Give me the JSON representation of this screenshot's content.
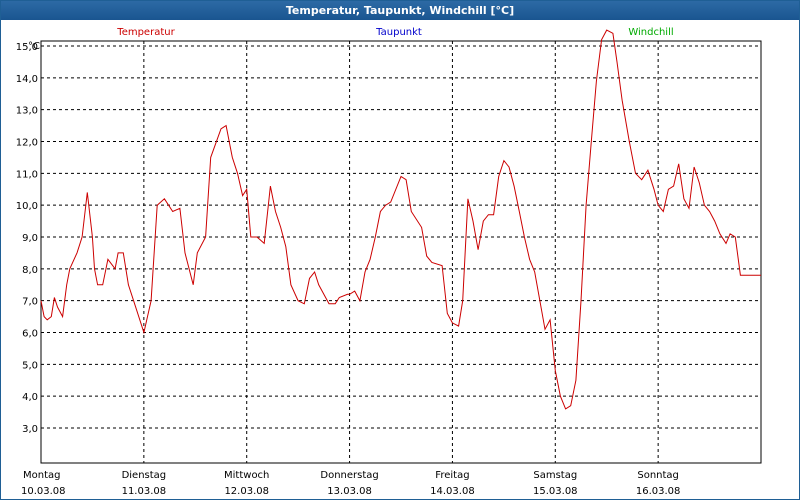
{
  "window": {
    "title": "Temperatur, Taupunkt, Windchill [°C]"
  },
  "colors": {
    "temperatur": "#cc0000",
    "taupunkt": "#0000cc",
    "windchill": "#00aa00",
    "titlebar": "#1f5f95"
  },
  "chart_data": {
    "type": "line",
    "title": "Temperatur, Taupunkt, Windchill [°C]",
    "ylabel": "°C",
    "ylim": [
      3.0,
      16.0
    ],
    "yticks": [
      "3,0",
      "4,0",
      "5,0",
      "6,0",
      "7,0",
      "8,0",
      "9,0",
      "10,0",
      "11,0",
      "12,0",
      "13,0",
      "14,0",
      "15,0"
    ],
    "xlim": [
      0,
      7
    ],
    "xticks": [
      {
        "day": "Montag",
        "date": "10.03.08"
      },
      {
        "day": "Dienstag",
        "date": "11.03.08"
      },
      {
        "day": "Mittwoch",
        "date": "12.03.08"
      },
      {
        "day": "Donnerstag",
        "date": "13.03.08"
      },
      {
        "day": "Freitag",
        "date": "14.03.08"
      },
      {
        "day": "Samstag",
        "date": "15.03.08"
      },
      {
        "day": "Sonntag",
        "date": "16.03.08"
      }
    ],
    "grid": true,
    "legend": [
      "Temperatur",
      "Taupunkt",
      "Windchill"
    ],
    "series": [
      {
        "name": "Temperatur",
        "x": [
          0,
          0.03,
          0.06,
          0.1,
          0.13,
          0.16,
          0.21,
          0.25,
          0.28,
          0.35,
          0.4,
          0.45,
          0.5,
          0.52,
          0.55,
          0.6,
          0.65,
          0.72,
          0.75,
          0.8,
          0.85,
          0.9,
          1.0,
          1.07,
          1.13,
          1.2,
          1.28,
          1.35,
          1.4,
          1.48,
          1.52,
          1.6,
          1.65,
          1.75,
          1.8,
          1.86,
          1.91,
          1.96,
          2.0,
          2.04,
          2.1,
          2.17,
          2.23,
          2.28,
          2.33,
          2.38,
          2.43,
          2.5,
          2.56,
          2.61,
          2.66,
          2.7,
          2.8,
          2.86,
          2.9,
          2.98,
          3.0,
          3.05,
          3.1,
          3.15,
          3.2,
          3.25,
          3.3,
          3.35,
          3.4,
          3.5,
          3.55,
          3.6,
          3.7,
          3.75,
          3.8,
          3.9,
          3.95,
          4.0,
          4.06,
          4.1,
          4.15,
          4.2,
          4.25,
          4.3,
          4.35,
          4.4,
          4.45,
          4.5,
          4.55,
          4.6,
          4.65,
          4.7,
          4.75,
          4.8,
          4.9,
          4.95,
          5.0,
          5.05,
          5.1,
          5.15,
          5.2,
          5.25,
          5.3,
          5.35,
          5.4,
          5.45,
          5.5,
          5.56,
          5.6,
          5.65,
          5.72,
          5.78,
          5.84,
          5.9,
          5.96,
          6.0,
          6.05,
          6.1,
          6.15,
          6.2,
          6.25,
          6.3,
          6.35,
          6.4,
          6.45,
          6.5,
          6.55,
          6.6,
          6.66,
          6.7,
          6.75,
          6.8,
          6.85,
          6.9,
          6.95,
          7.0
        ],
        "y": [
          7.0,
          6.5,
          6.4,
          6.5,
          7.1,
          6.8,
          6.5,
          7.5,
          8.0,
          8.5,
          9.0,
          10.4,
          9.0,
          8.0,
          7.5,
          7.5,
          8.3,
          8.0,
          8.5,
          8.5,
          7.5,
          7.0,
          6.0,
          7.0,
          10.0,
          10.2,
          9.8,
          9.9,
          8.5,
          7.5,
          8.5,
          9.0,
          11.5,
          12.4,
          12.5,
          11.5,
          11.0,
          10.3,
          10.5,
          9.0,
          9.0,
          8.8,
          10.6,
          9.8,
          9.3,
          8.7,
          7.5,
          7.0,
          6.9,
          7.7,
          7.9,
          7.5,
          6.9,
          6.9,
          7.1,
          7.2,
          7.2,
          7.3,
          7.0,
          7.9,
          8.3,
          9.0,
          9.8,
          10.0,
          10.1,
          10.9,
          10.8,
          9.8,
          9.3,
          8.4,
          8.2,
          8.1,
          6.6,
          6.3,
          6.2,
          7.0,
          10.2,
          9.5,
          8.6,
          9.5,
          9.7,
          9.7,
          10.9,
          11.4,
          11.2,
          10.6,
          9.8,
          9.0,
          8.3,
          7.9,
          6.1,
          6.4,
          4.8,
          4.0,
          3.6,
          3.7,
          4.5,
          7.0,
          10.0,
          12.0,
          13.9,
          15.2,
          15.5,
          15.4,
          14.5,
          13.3,
          12.0,
          11.0,
          10.8,
          11.1,
          10.5,
          10.0,
          9.8,
          10.5,
          10.6,
          11.3,
          10.2,
          9.9,
          11.2,
          10.7,
          10.0,
          9.8,
          9.5,
          9.1,
          8.8,
          9.1,
          9.0,
          7.8,
          7.8,
          7.8,
          7.8,
          7.8
        ]
      },
      {
        "name": "Taupunkt",
        "x": [],
        "y": []
      },
      {
        "name": "Windchill",
        "x": [],
        "y": []
      }
    ]
  }
}
